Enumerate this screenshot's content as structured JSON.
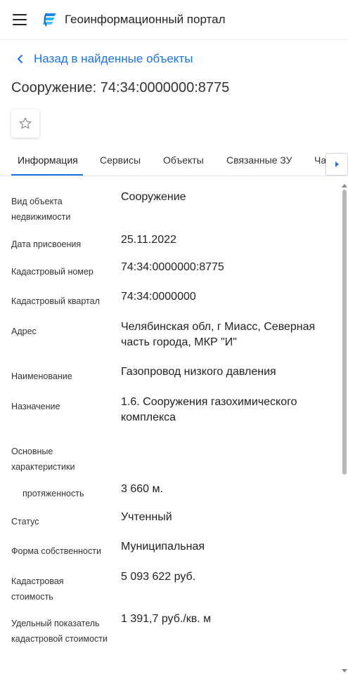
{
  "header": {
    "title": "Геоинформационный портал",
    "menu_icon": "hamburger-icon",
    "logo_icon": "portal-logo-icon"
  },
  "nav": {
    "back_label": "Назад в найденные объекты"
  },
  "object": {
    "title": "Сооружение: 74:34:0000000:8775"
  },
  "tabs": [
    {
      "label": "Информация"
    },
    {
      "label": "Сервисы"
    },
    {
      "label": "Объекты"
    },
    {
      "label": "Связанные ЗУ"
    },
    {
      "label": "Ча"
    }
  ],
  "details": [
    {
      "label": "Вид объекта недвижимости",
      "value": "Сооружение"
    },
    {
      "label": "Дата присвоения",
      "value": "25.11.2022"
    },
    {
      "label": "Кадастровый номер",
      "value": "74:34:0000000:8775"
    },
    {
      "label": "Кадастровый квартал",
      "value": "74:34:0000000"
    },
    {
      "label": "Адрес",
      "value": "Челябинская обл, г Миасс, Северная часть города, МКР \"И\""
    },
    {
      "label": "Наименование",
      "value": "Газопровод низкого давления"
    },
    {
      "label": "Назначение",
      "value": "1.6. Сооружения газохимического комплекса"
    },
    {
      "label": "Основные характеристики",
      "value": ""
    },
    {
      "label": "протяженность",
      "value": "3 660 м."
    },
    {
      "label": "Статус",
      "value": "Учтенный"
    },
    {
      "label": "Форма собственности",
      "value": "Муниципальная"
    },
    {
      "label": "Кадастровая стоимость",
      "value": "5 093 622 руб."
    },
    {
      "label": "Удельный показатель кадастровой стоимости",
      "value": "1 391,7 руб./кв. м"
    }
  ],
  "colors": {
    "accent": "#1a73e8",
    "text": "#222222",
    "muted": "#333333"
  }
}
